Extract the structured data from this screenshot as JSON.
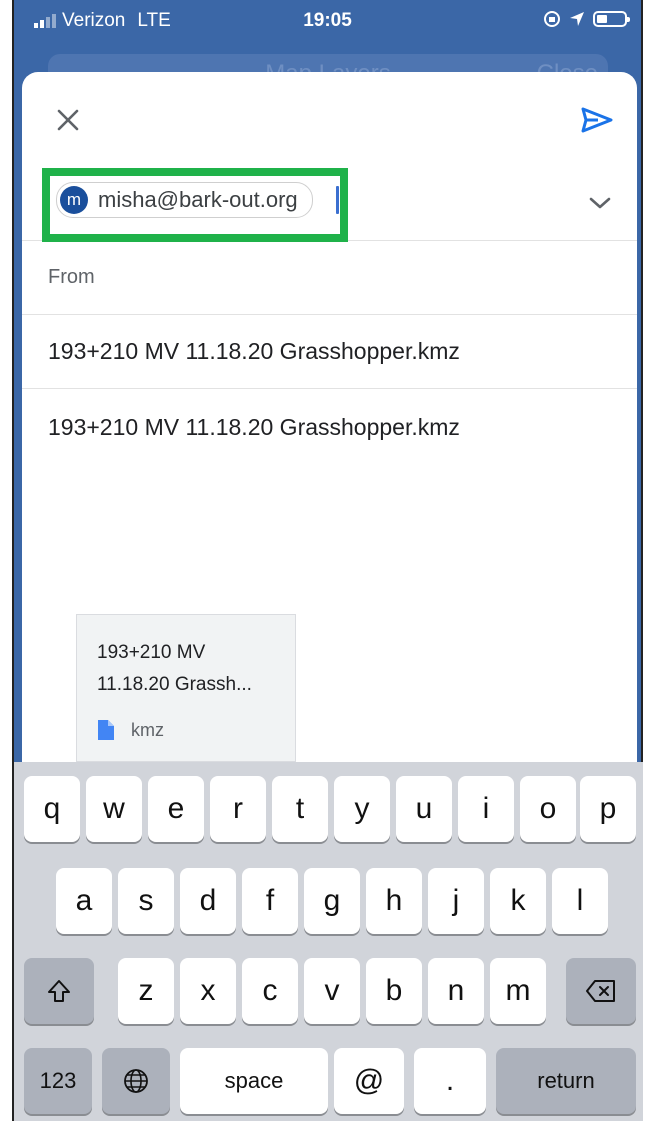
{
  "status_bar": {
    "carrier": "Verizon",
    "network": "LTE",
    "time": "19:05"
  },
  "background_sheet": {
    "title": "Map Layers",
    "close_label": "Close"
  },
  "compose": {
    "recipient": {
      "avatar_letter": "m",
      "email": "misha@bark-out.org"
    },
    "from_label": "From",
    "subject": "193+210 MV 11.18.20 Grasshopper.kmz",
    "body": "193+210 MV 11.18.20 Grasshopper.kmz",
    "attachment": {
      "name_line1": "193+210 MV",
      "name_line2": "11.18.20 Grassh...",
      "type": "kmz"
    },
    "icons": {
      "close": "close-icon",
      "send": "send-icon",
      "expand": "chevron-down-icon",
      "file": "file-icon"
    },
    "colors": {
      "accent": "#1a73e8",
      "highlight": "#1fb24a",
      "avatar": "#1a4f9c"
    }
  },
  "keyboard": {
    "row1": [
      "q",
      "w",
      "e",
      "r",
      "t",
      "y",
      "u",
      "i",
      "o",
      "p"
    ],
    "row2": [
      "a",
      "s",
      "d",
      "f",
      "g",
      "h",
      "j",
      "k",
      "l"
    ],
    "row3": [
      "z",
      "x",
      "c",
      "v",
      "b",
      "n",
      "m"
    ],
    "numbers_label": "123",
    "space_label": "space",
    "at_label": "@",
    "period_label": ".",
    "return_label": "return"
  }
}
